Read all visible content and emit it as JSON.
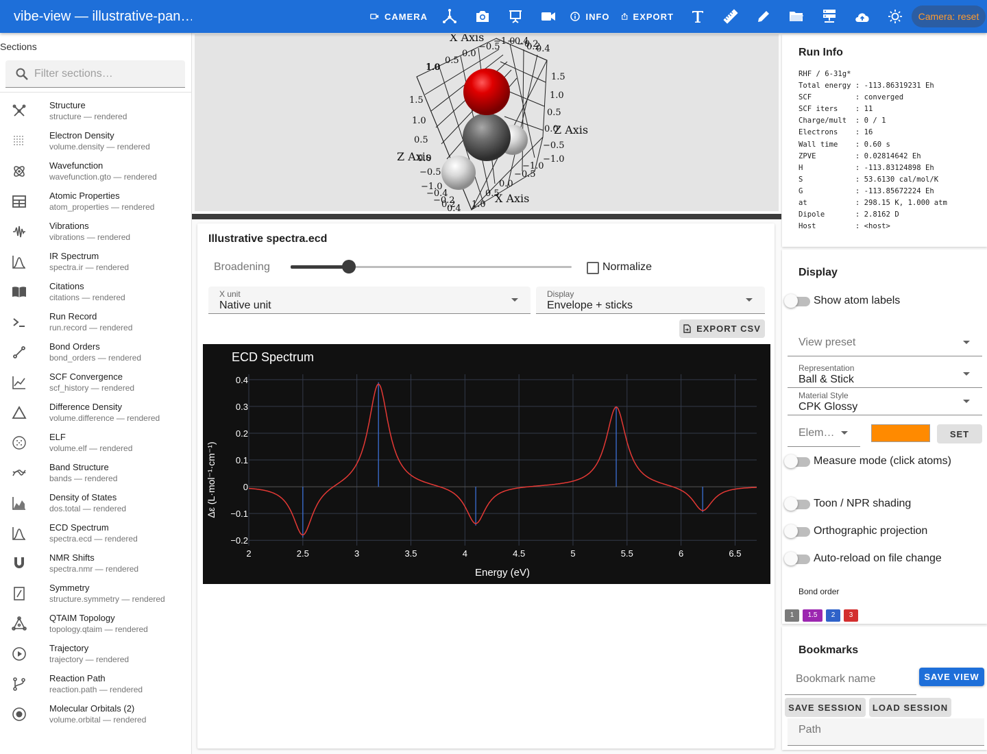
{
  "app": {
    "title": "vibe-view — illustrative-pan…"
  },
  "toolbar": {
    "camera_label": "CAMERA",
    "info_label": "INFO",
    "export_label": "EXPORT",
    "camera_reset_label": "Camera: reset"
  },
  "sidebar": {
    "title": "Sections",
    "search_placeholder": "Filter sections…",
    "items": [
      {
        "name": "Structure",
        "sub": "structure — rendered",
        "icon": "structure-icon"
      },
      {
        "name": "Electron Density",
        "sub": "volume.density — rendered",
        "icon": "grid-dots-icon"
      },
      {
        "name": "Wavefunction",
        "sub": "wavefunction.gto — rendered",
        "icon": "atom-icon"
      },
      {
        "name": "Atomic Properties",
        "sub": "atom_properties — rendered",
        "icon": "table-icon"
      },
      {
        "name": "Vibrations",
        "sub": "vibrations — rendered",
        "icon": "waveform-icon"
      },
      {
        "name": "IR Spectrum",
        "sub": "spectra.ir — rendered",
        "icon": "peak-chart-icon"
      },
      {
        "name": "Citations",
        "sub": "citations — rendered",
        "icon": "book-icon"
      },
      {
        "name": "Run Record",
        "sub": "run.record — rendered",
        "icon": "terminal-icon"
      },
      {
        "name": "Bond Orders",
        "sub": "bond_orders — rendered",
        "icon": "bond-icon"
      },
      {
        "name": "SCF Convergence",
        "sub": "scf_history — rendered",
        "icon": "line-chart-icon"
      },
      {
        "name": "Difference Density",
        "sub": "volume.difference — rendered",
        "icon": "triangle-icon"
      },
      {
        "name": "ELF",
        "sub": "volume.elf — rendered",
        "icon": "dotted-circle-icon"
      },
      {
        "name": "Band Structure",
        "sub": "bands — rendered",
        "icon": "bands-icon"
      },
      {
        "name": "Density of States",
        "sub": "dos.total — rendered",
        "icon": "area-chart-icon"
      },
      {
        "name": "ECD Spectrum",
        "sub": "spectra.ecd — rendered",
        "icon": "peak-chart-icon"
      },
      {
        "name": "NMR Shifts",
        "sub": "spectra.nmr — rendered",
        "icon": "magnet-icon"
      },
      {
        "name": "Symmetry",
        "sub": "structure.symmetry — rendered",
        "icon": "symmetry-icon"
      },
      {
        "name": "QTAIM Topology",
        "sub": "topology.qtaim — rendered",
        "icon": "graph-icon"
      },
      {
        "name": "Trajectory",
        "sub": "trajectory — rendered",
        "icon": "play-circle-icon"
      },
      {
        "name": "Reaction Path",
        "sub": "reaction.path — rendered",
        "icon": "branch-icon"
      },
      {
        "name": "Molecular Orbitals (2)",
        "sub": "volume.orbital — rendered",
        "icon": "orbital-icon"
      }
    ]
  },
  "viewer": {
    "axis_labels": [
      "X Axis",
      "Z Axis",
      "Z Axis",
      "X Axis"
    ],
    "ticks_left": [
      "1.0",
      "1.5",
      "1.0",
      "0.5",
      "0.0",
      "−0.5",
      "−1.0",
      "−0.4",
      "−0.2",
      "0.2",
      "0.4"
    ],
    "ticks_top": [
      "−1.0",
      "−0.5",
      "0.0",
      "0.5",
      "1.0",
      "−0.4",
      "−0.2",
      "0.2",
      "0.4"
    ],
    "ticks_right": [
      "1.5",
      "1.0",
      "0.5",
      "0.0",
      "−0.5",
      "−1.0",
      "−1.0",
      "−0.5",
      "0.0",
      "0.5",
      "1.0"
    ]
  },
  "spectrum": {
    "title": "Illustrative spectra.ecd",
    "broadening_label": "Broadening",
    "broadening_value": 0.21,
    "normalize_label": "Normalize",
    "xunit_caption": "X unit",
    "xunit_value": "Native unit",
    "display_caption": "Display",
    "display_value": "Envelope + sticks",
    "export_label": "EXPORT CSV"
  },
  "chart_data": {
    "type": "line",
    "title": "ECD Spectrum",
    "xlabel": "Energy (eV)",
    "ylabel": "Δε (L·mol⁻¹·cm⁻¹)",
    "xlim": [
      2.0,
      6.7
    ],
    "ylim": [
      -0.22,
      0.42
    ],
    "x_ticks": [
      "2",
      "2.5",
      "3",
      "3.5",
      "4",
      "4.5",
      "5",
      "5.5",
      "6",
      "6.5"
    ],
    "y_ticks": [
      "0.4",
      "0.3",
      "0.2",
      "0.1",
      "0",
      "−0.1",
      "−0.2"
    ],
    "sticks": [
      {
        "x": 2.5,
        "y": -0.19
      },
      {
        "x": 3.2,
        "y": 0.39
      },
      {
        "x": 4.1,
        "y": -0.145
      },
      {
        "x": 5.4,
        "y": 0.3
      },
      {
        "x": 6.2,
        "y": -0.095
      }
    ],
    "grid": true,
    "colors": {
      "background": "#111111",
      "envelope": "#e53935",
      "sticks": "#3b6fd6",
      "grid": "#333a4a"
    }
  },
  "run_info": {
    "title": "Run Info",
    "lines": [
      "RHF / 6-31g*",
      "Total energy : -113.86319231 Eh",
      "SCF          : converged",
      "SCF iters    : 11",
      "Charge/mult  : 0 / 1",
      "Electrons    : 16",
      "Wall time    : 0.60 s",
      "ZPVE         : 0.02814642 Eh",
      "H            : -113.83124898 Eh",
      "S            : 53.6130 cal/mol/K",
      "G            : -113.85672224 Eh",
      "at           : 298.15 K, 1.000 atm",
      "Dipole       : 2.8162 D",
      "Host         : <host>"
    ]
  },
  "display": {
    "title": "Display",
    "show_atom_labels": "Show atom labels",
    "view_preset_placeholder": "View preset",
    "representation_caption": "Representation",
    "representation_value": "Ball & Stick",
    "material_caption": "Material Style",
    "material_value": "CPK Glossy",
    "element_placeholder": "Elem…",
    "element_color": "#ff8a00",
    "set_label": "SET",
    "measure_mode": "Measure mode (click atoms)",
    "toon_shading": "Toon / NPR shading",
    "orthographic": "Orthographic projection",
    "auto_reload": "Auto-reload on file change",
    "bond_order_label": "Bond order",
    "bond_orders": [
      {
        "label": "1",
        "color": "#7a7a7a"
      },
      {
        "label": "1.5",
        "color": "#9c27b0"
      },
      {
        "label": "2",
        "color": "#2f62c9"
      },
      {
        "label": "3",
        "color": "#d32f2f"
      }
    ]
  },
  "bookmarks": {
    "title": "Bookmarks",
    "name_placeholder": "Bookmark name",
    "save_view_label": "SAVE VIEW",
    "save_session_label": "SAVE SESSION",
    "load_session_label": "LOAD SESSION",
    "path_placeholder": "Path"
  }
}
